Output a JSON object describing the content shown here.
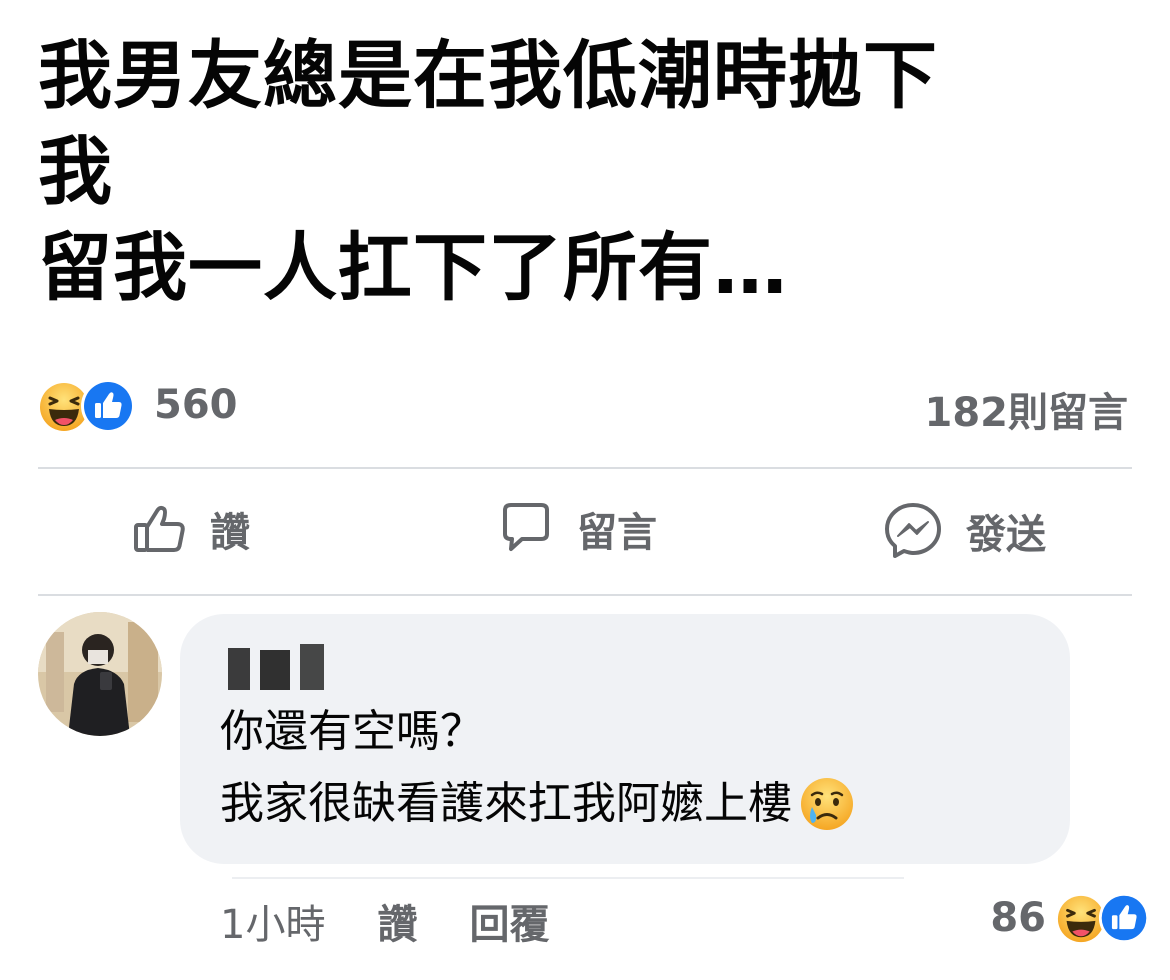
{
  "post": {
    "lines": [
      "我男友總是在我低潮時拋下",
      "我",
      "留我一人扛下了所有…"
    ]
  },
  "reactions": {
    "count": "560",
    "icons": [
      "haha-icon",
      "like-icon"
    ]
  },
  "comments_count": "182則留言",
  "actions": {
    "like": "讚",
    "comment": "留言",
    "send": "發送"
  },
  "comment": {
    "lines": [
      "你還有空嗎？",
      "我家很缺看護來扛我阿嬤上樓"
    ],
    "emoji": "crying-face-icon",
    "time": "1小時",
    "like_label": "讚",
    "reply_label": "回覆",
    "reaction_count": "86"
  },
  "colors": {
    "muted_text": "#65676b",
    "bubble_bg": "#f0f2f5",
    "like_blue": "#1877f2",
    "haha_yellow": "#f7b125"
  }
}
